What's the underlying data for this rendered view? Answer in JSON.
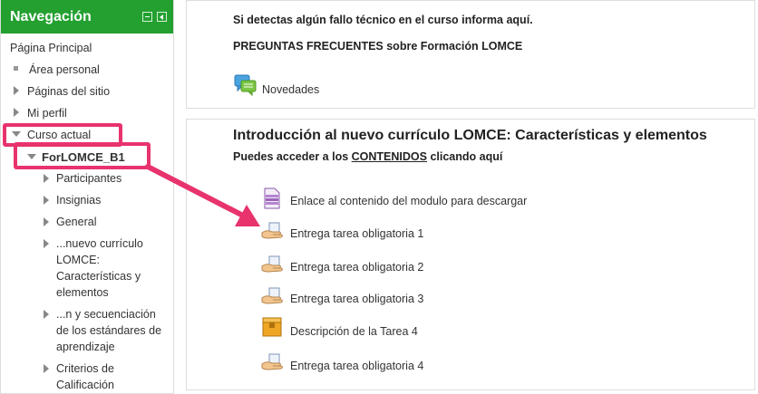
{
  "nav": {
    "title": "Navegación",
    "items": [
      {
        "label": "Página Principal"
      },
      {
        "label": "Área personal"
      },
      {
        "label": "Páginas del sitio"
      },
      {
        "label": "Mi perfil"
      },
      {
        "label": "Curso actual"
      },
      {
        "label": "ForLOMCE_B1"
      },
      {
        "label": "Participantes"
      },
      {
        "label": "Insignias"
      },
      {
        "label": "General"
      },
      {
        "label": [
          "...nuevo currículo",
          "LOMCE:",
          "Características y",
          "elementos"
        ]
      },
      {
        "label": [
          "...n y secuenciación",
          "de los estándares de",
          "aprendizaje"
        ]
      },
      {
        "label": [
          "Criterios de",
          "Calificación"
        ]
      }
    ]
  },
  "section0": {
    "line1": "Si detectas algún fallo técnico en el curso informa aquí.",
    "line2": "PREGUNTAS FRECUENTES sobre Formación LOMCE",
    "forum_label": "Novedades"
  },
  "section1": {
    "title": "Introducción al nuevo currículo LOMCE: Características y elementos",
    "summary_before": "Puedes acceder a los ",
    "summary_link": "CONTENIDOS",
    "summary_after": " clicando aquí",
    "activities": [
      {
        "label": "Enlace al contenido del modulo para descargar",
        "icon": "file-icon"
      },
      {
        "label": "Entrega tarea obligatoria 1",
        "icon": "assignment-icon"
      },
      {
        "label": "Entrega tarea obligatoria 2",
        "icon": "assignment-icon"
      },
      {
        "label": "Entrega tarea obligatoria 3",
        "icon": "assignment-icon"
      },
      {
        "label": "Descripción de la Tarea 4",
        "icon": "resource-box-icon"
      },
      {
        "label": "Entrega tarea obligatoria 4",
        "icon": "assignment-icon"
      }
    ]
  },
  "colors": {
    "nav_header": "#23a030",
    "highlight": "#e8336d"
  }
}
